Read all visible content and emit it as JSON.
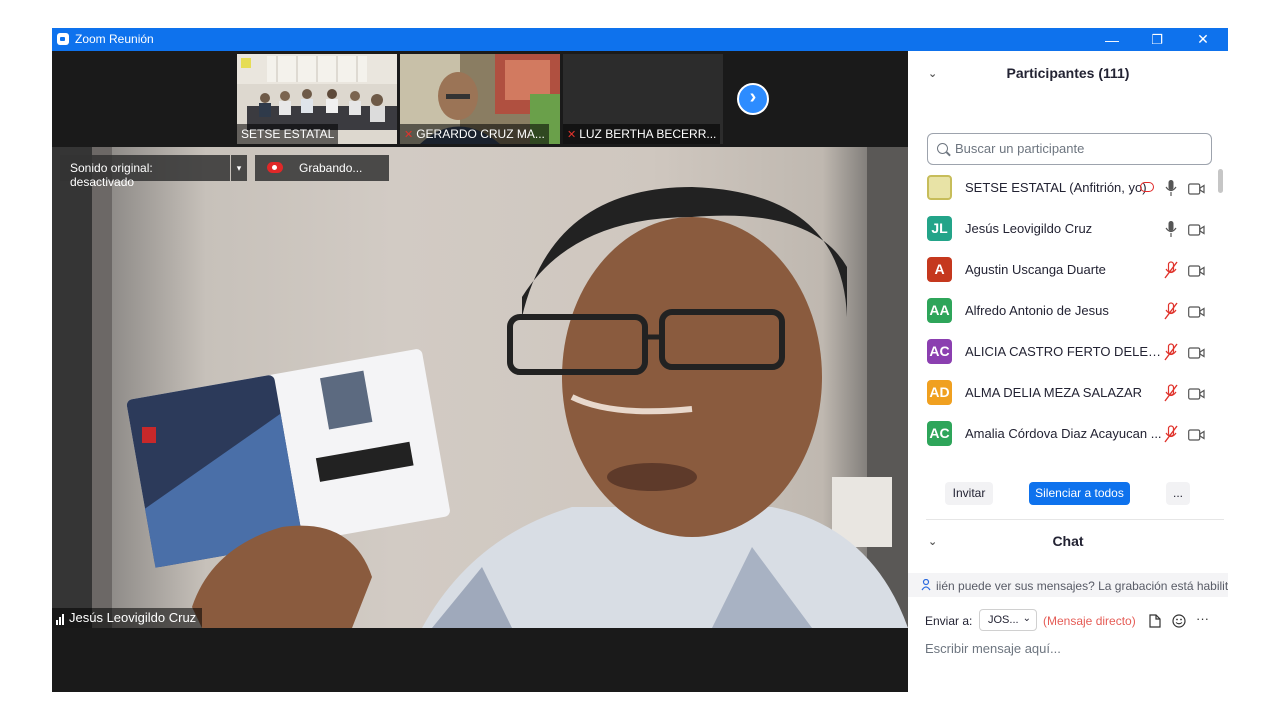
{
  "window": {
    "title": "Zoom Reunión",
    "controls": {
      "minimize": "—",
      "restore": "❐",
      "close": "✕"
    }
  },
  "thumbnails": [
    {
      "label": "SETSE ESTATAL",
      "muted": false
    },
    {
      "label": "GERARDO CRUZ MA...",
      "muted": true
    },
    {
      "label": "LUZ BERTHA BECERR...",
      "muted": true
    }
  ],
  "next_button": "›",
  "speaker": {
    "sound_label": "Sonido original: desactivado",
    "recording_label": "Grabando...",
    "name": "Jesús Leovigildo Cruz"
  },
  "participants": {
    "header": "Participantes (111)",
    "search_placeholder": "Buscar un participante",
    "list": [
      {
        "initials": "",
        "name": "SETSE ESTATAL (Anfitrión, yo)",
        "color": "#e8e3a6",
        "mic": "on",
        "host": true
      },
      {
        "initials": "JL",
        "name": "Jesús Leovigildo Cruz",
        "color": "#23a489",
        "mic": "on"
      },
      {
        "initials": "A",
        "name": "Agustin Uscanga Duarte",
        "color": "#c5381e",
        "mic": "off"
      },
      {
        "initials": "AA",
        "name": "Alfredo Antonio de Jesus",
        "color": "#2ea55a",
        "mic": "off"
      },
      {
        "initials": "AC",
        "name": "ALICIA CASTRO FERTO DELEGAC...",
        "color": "#8b3fb0",
        "mic": "off"
      },
      {
        "initials": "AD",
        "name": "ALMA DELIA MEZA SALAZAR",
        "color": "#f0a020",
        "mic": "off"
      },
      {
        "initials": "AC",
        "name": "Amalia Córdova Diaz Acayucan ...",
        "color": "#2ea55a",
        "mic": "off"
      }
    ],
    "buttons": {
      "invite": "Invitar",
      "mute_all": "Silenciar a todos",
      "more": "..."
    }
  },
  "chat": {
    "header": "Chat",
    "notice": "iién puede ver sus mensajes? La grabación está habilit",
    "send_to_label": "Enviar a:",
    "send_to_value": "JOS...",
    "direct_label": "(Mensaje directo)",
    "input_placeholder": "Escribir mensaje aquí..."
  },
  "colors": {
    "accent": "#0e72ed",
    "button_blue": "#0e72ed",
    "muted_red": "#e0332c"
  }
}
